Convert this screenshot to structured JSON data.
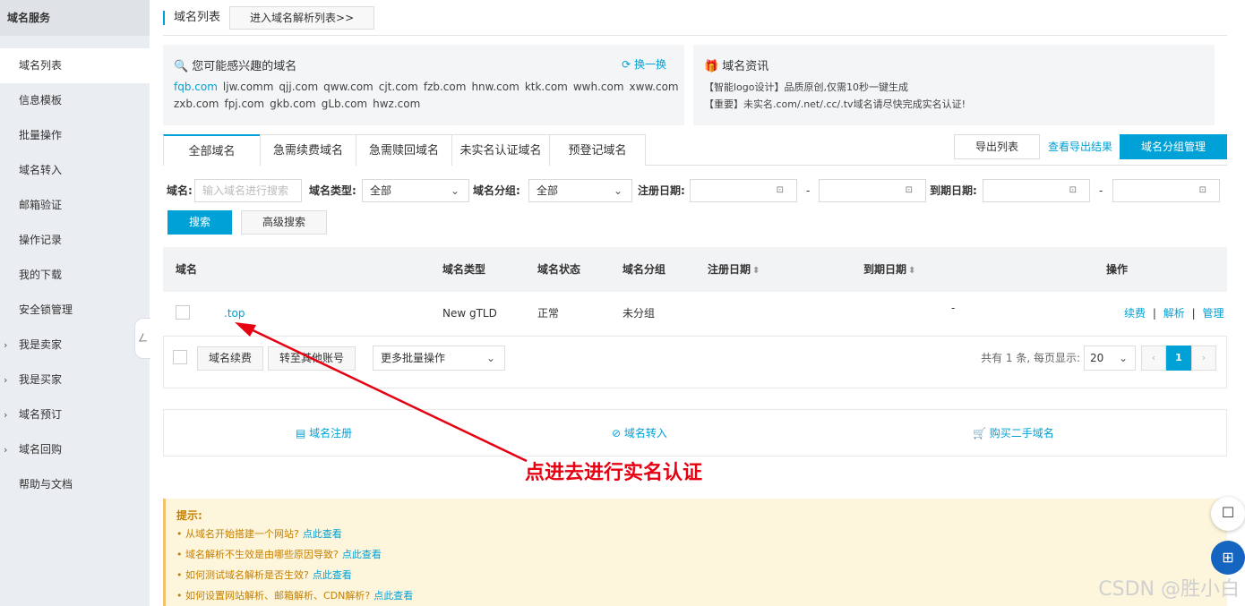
{
  "sidebar": {
    "title": "域名服务",
    "items": [
      {
        "label": "域名列表",
        "active": true
      },
      {
        "label": "信息模板"
      },
      {
        "label": "批量操作"
      },
      {
        "label": "域名转入"
      },
      {
        "label": "邮箱验证"
      },
      {
        "label": "操作记录"
      },
      {
        "label": "我的下载"
      },
      {
        "label": "安全锁管理"
      },
      {
        "label": "我是卖家",
        "caret": "›"
      },
      {
        "label": "我是买家",
        "caret": "›"
      },
      {
        "label": "域名预订",
        "caret": "›"
      },
      {
        "label": "域名回购",
        "caret": "›"
      },
      {
        "label": "帮助与文档"
      }
    ],
    "collapse_glyph": "ㄥ"
  },
  "header": {
    "title": "域名列表",
    "dns_button": "进入域名解析列表>>"
  },
  "suggest": {
    "title": "您可能感兴趣的域名",
    "refresh": "换一换",
    "domains": [
      "fqb.com",
      "ljw.comm",
      "qjj.com",
      "qww.com",
      "cjt.com",
      "fzb.com",
      "hnw.com",
      "ktk.com",
      "wwh.com",
      "xww.com",
      "zxb.com",
      "fpj.com",
      "gkb.com",
      "gLb.com",
      "hwz.com"
    ]
  },
  "news": {
    "title": "域名资讯",
    "items": [
      "【智能logo设计】品质原创,仅需10秒一键生成",
      "【重要】未实名.com/.net/.cc/.tv域名请尽快完成实名认证!"
    ]
  },
  "tabs": [
    "全部域名",
    "急需续费域名",
    "急需赎回域名",
    "未实名认证域名",
    "预登记域名"
  ],
  "actions": {
    "export": "导出列表",
    "view_export": "查看导出结果",
    "group_manage": "域名分组管理"
  },
  "filters": {
    "domain_label": "域名:",
    "domain_placeholder": "输入域名进行搜索",
    "type_label": "域名类型:",
    "type_value": "全部",
    "group_label": "域名分组:",
    "group_value": "全部",
    "reg_label": "注册日期:",
    "exp_label": "到期日期:",
    "dash": "-",
    "search": "搜索",
    "advanced": "高级搜索"
  },
  "table": {
    "headers": {
      "domain": "域名",
      "type": "域名类型",
      "status": "域名状态",
      "group": "域名分组",
      "reg_date": "注册日期",
      "exp_date": "到期日期",
      "ops": "操作"
    },
    "rows": [
      {
        "domain": ".top",
        "type": "New gTLD",
        "status": "正常",
        "group": "未分组",
        "exp_date": "-",
        "op_renew": "续费",
        "op_dns": "解析",
        "op_manage": "管理"
      }
    ],
    "sep": "|"
  },
  "batch": {
    "renew": "域名续费",
    "transfer": "转至其他账号",
    "more": "更多批量操作",
    "total": "共有 1 条, 每页显示:",
    "page_size": "20",
    "page_current": "1",
    "prev": "‹",
    "next": "›"
  },
  "quick_links": {
    "register": "域名注册",
    "transfer_in": "域名转入",
    "buy_used": "购买二手域名"
  },
  "tips": {
    "title": "提示:",
    "items": [
      {
        "text": "• 从域名开始搭建一个网站?",
        "link": "点此查看"
      },
      {
        "text": "• 域名解析不生效是由哪些原因导致?",
        "link": "点此查看"
      },
      {
        "text": "• 如何测试域名解析是否生效?",
        "link": "点此查看"
      },
      {
        "text": "• 如何设置网站解析、邮箱解析、CDN解析?",
        "link": "点此查看"
      }
    ]
  },
  "annotation": "点进去进行实名认证",
  "watermark": "CSDN @胜小白",
  "colors": {
    "accent": "#00a1d6",
    "arrow": "#e60012",
    "tip_bg": "#fdf5dc"
  }
}
